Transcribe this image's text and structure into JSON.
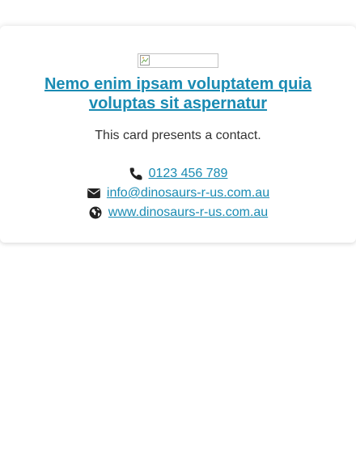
{
  "card": {
    "title": "Nemo enim ipsam voluptatem quia voluptas sit aspernatur",
    "description": "This card presents a contact.",
    "logo_icon": "broken-image-icon"
  },
  "contacts": {
    "phone": {
      "icon": "phone-icon",
      "text": "0123 456 789"
    },
    "email": {
      "icon": "envelope-icon",
      "text": "info@dinosaurs-r-us.com.au"
    },
    "website": {
      "icon": "globe-icon",
      "text": "www.dinosaurs-r-us.com.au"
    }
  },
  "colors": {
    "link": "#1a8bb3",
    "text": "#333333",
    "icon": "#222222"
  }
}
